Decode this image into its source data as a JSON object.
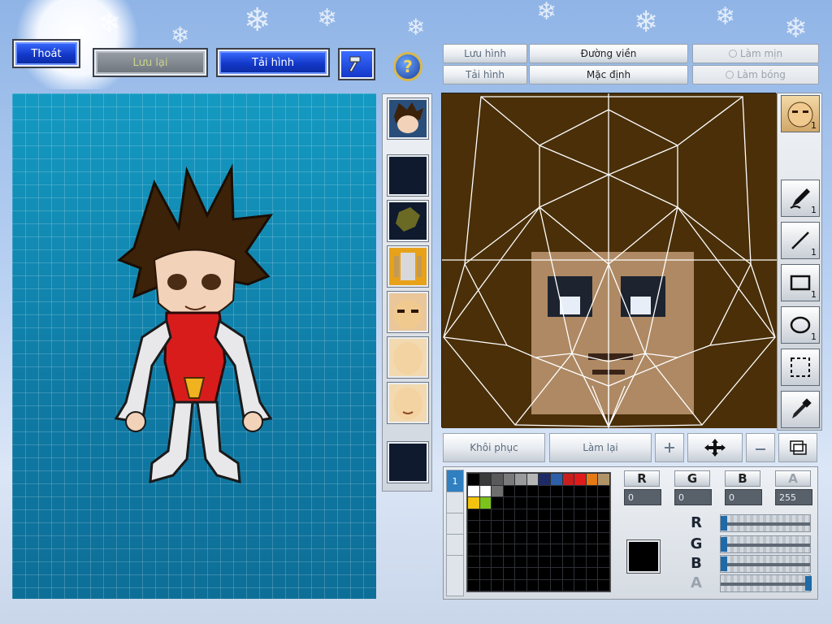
{
  "top_buttons": {
    "exit": "Thoát",
    "save": "Lưu lại",
    "reload": "Tải hình"
  },
  "header_tabs": {
    "save_image": "Lưu hình",
    "outline": "Đường viền",
    "smooth": "Làm mịn",
    "reload_image": "Tải hình",
    "default": "Mặc định",
    "shade": "Làm bóng"
  },
  "tools": {
    "face_count": "1",
    "pen_count": "1",
    "line_count": "1",
    "rect_count": "1",
    "ellipse_count": "1"
  },
  "actions": {
    "restore": "Khôi phục",
    "redo": "Làm lại"
  },
  "color": {
    "r_label": "R",
    "g_label": "G",
    "b_label": "B",
    "a_label": "A",
    "r": "0",
    "g": "0",
    "b": "0",
    "a": "255",
    "selected": "#000000",
    "slider_r": 0,
    "slider_g": 0,
    "slider_b": 0,
    "slider_a": 100
  },
  "palette": [
    "#000000",
    "#3a3a3a",
    "#5a5a5a",
    "#7a7a7a",
    "#9a9a9a",
    "#b5b5b5",
    "#1d2a66",
    "#2c5fa8",
    "#c81e1e",
    "#e11b1b",
    "#e57a14",
    "#b09468",
    "#ffffff",
    "#ffffff",
    "#6e6e6e",
    "#000000",
    "#000000",
    "#000000",
    "#000000",
    "#000000",
    "#000000",
    "#000000",
    "#000000",
    "#000000",
    "#f2c40f",
    "#7bc21b",
    "#000000",
    "#000000",
    "#000000",
    "#000000",
    "#000000",
    "#000000",
    "#000000",
    "#000000",
    "#000000",
    "#000000"
  ],
  "layer_index": "1"
}
